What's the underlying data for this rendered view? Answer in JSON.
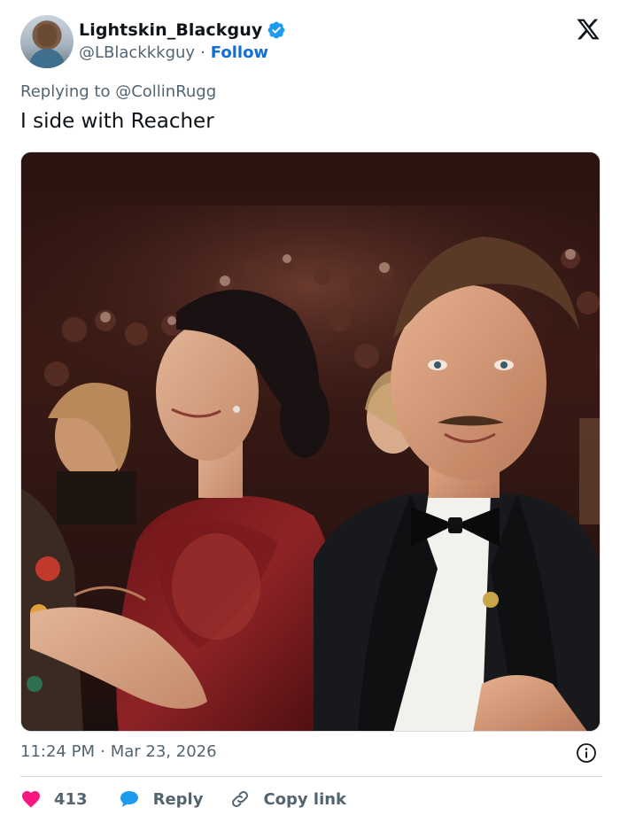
{
  "user": {
    "display_name": "Lightskin_Blackguy",
    "handle": "@LBlackkkguy",
    "separator": "·",
    "follow_label": "Follow",
    "verified": true,
    "avatar_icon": "avatar-photo"
  },
  "brand": {
    "logo": "x-logo-icon"
  },
  "tweet": {
    "replying_to": "Replying to @CollinRugg",
    "text": "I side with Reacher",
    "media": "photo of man in tuxedo smiling at an awards ceremony with a woman in a red dress beside him",
    "time": "11:24 PM",
    "date_separator": "·",
    "date": "Mar 23, 2026"
  },
  "actions": {
    "like_count": "413",
    "reply_label": "Reply",
    "copy_link_label": "Copy link"
  },
  "colors": {
    "like": "#f91880",
    "reply": "#1d9bf0",
    "follow": "#0f6fd6",
    "verified": "#1d9bf0",
    "muted": "#536471",
    "text": "#0f1419"
  }
}
